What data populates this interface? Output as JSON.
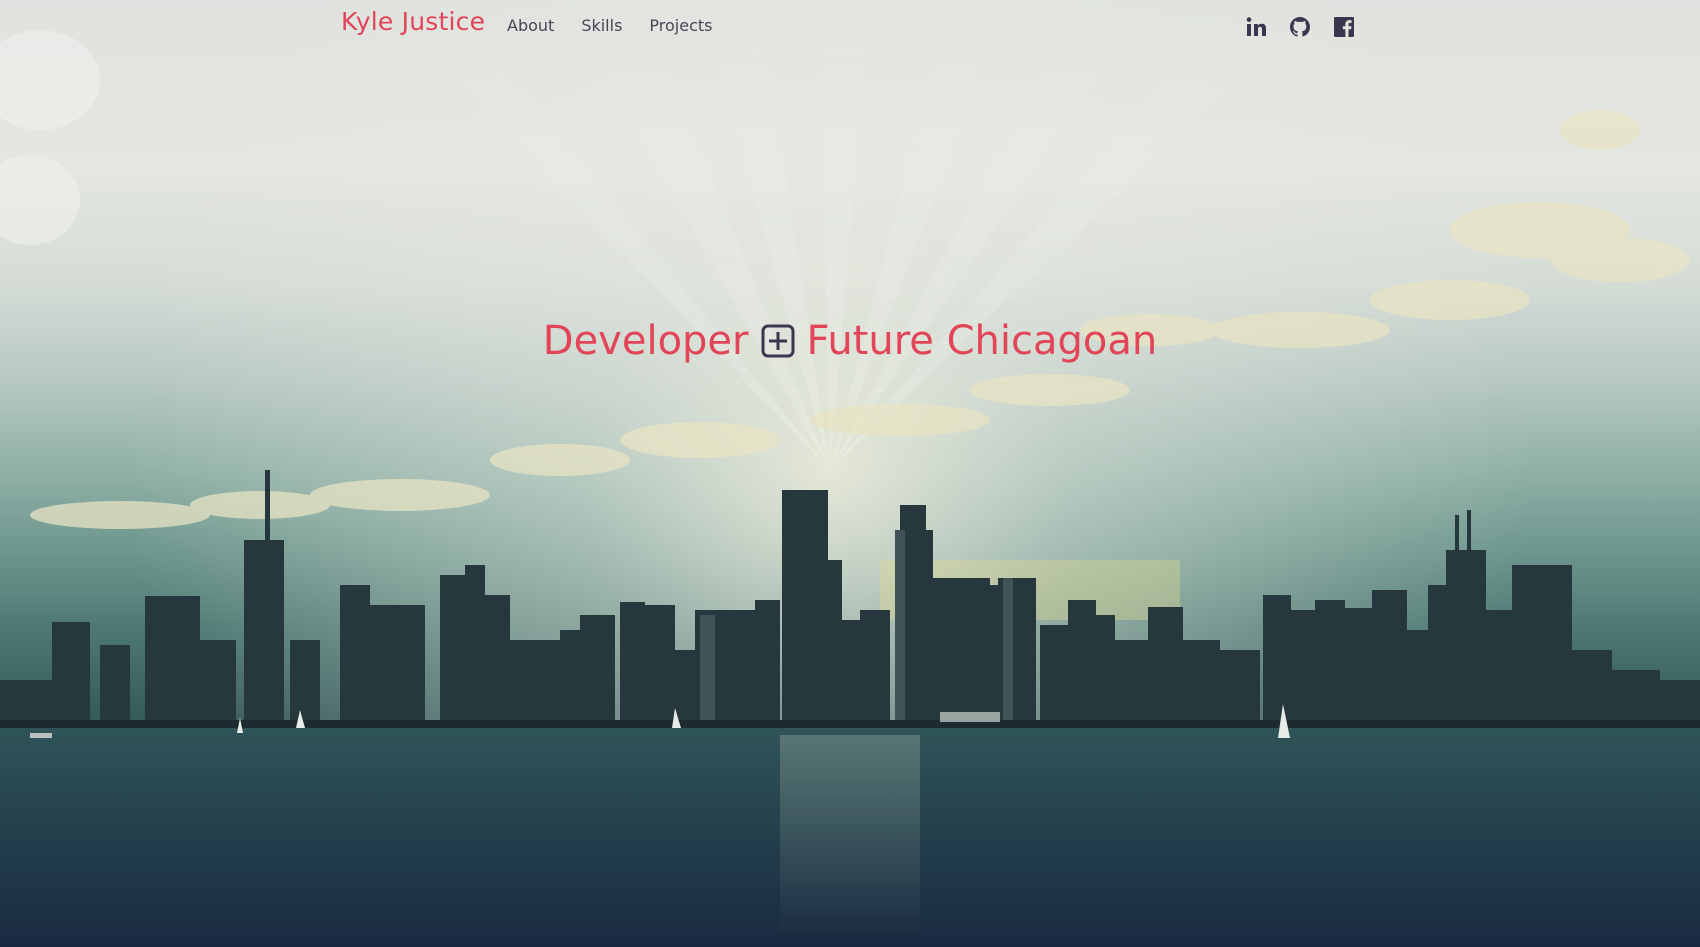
{
  "header": {
    "brand": "Kyle Justice",
    "nav": [
      {
        "label": "About"
      },
      {
        "label": "Skills"
      },
      {
        "label": "Projects"
      }
    ],
    "social_icons": [
      "linkedin-icon",
      "github-icon",
      "facebook-icon"
    ]
  },
  "hero": {
    "tagline_left": "Developer",
    "tagline_symbol_icon": "squared-plus-icon",
    "tagline_right": "Future Chicagoan"
  },
  "colors": {
    "accent": "#e24458",
    "nav_text": "#4a4557",
    "icon": "#3b3550"
  }
}
